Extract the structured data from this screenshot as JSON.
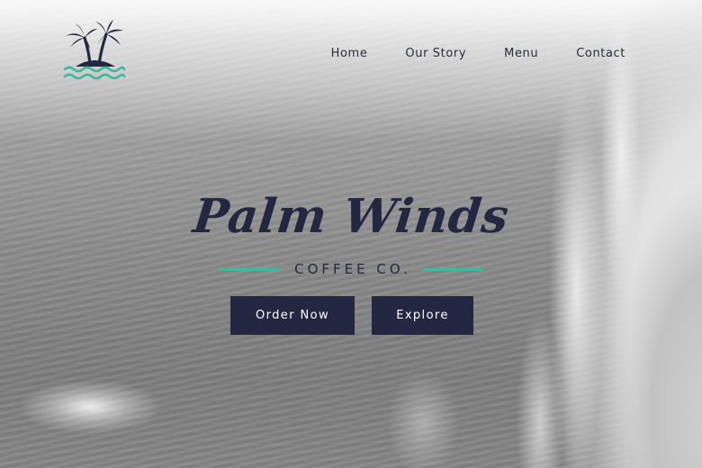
{
  "brand": {
    "title": "Palm Winds",
    "subtitle": "COFFEE CO.",
    "accent_color": "#3fb89b",
    "ink_color": "#232741",
    "logo_icon": "palm-island-icon"
  },
  "nav": {
    "items": [
      {
        "label": "Home"
      },
      {
        "label": "Our Story"
      },
      {
        "label": "Menu"
      },
      {
        "label": "Contact"
      }
    ]
  },
  "cta": {
    "order_label": "Order Now",
    "explore_label": "Explore"
  },
  "background": {
    "description_icon": "ocean-beach-photo"
  }
}
